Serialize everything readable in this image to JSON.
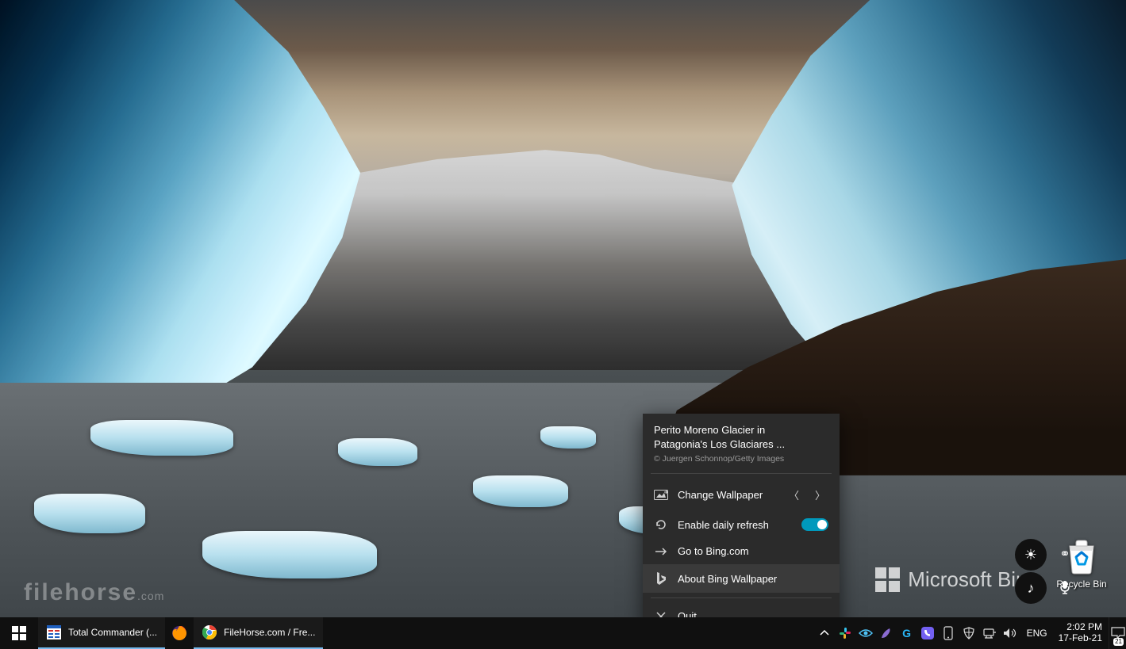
{
  "wallpaper_description": "Perito Moreno Glacier in Patagonia with snowy mountains and blue ice formations",
  "watermark": {
    "text": "filehorse",
    "suffix": ".com"
  },
  "desktop_icons": {
    "recycle_bin": "Recycle Bin"
  },
  "ms_bing_logo": "Microsoft Bing",
  "popup": {
    "title_line1": "Perito Moreno Glacier in",
    "title_line2": "Patagonia's Los Glaciares ...",
    "credit": "©  Juergen Schonnop/Getty Images",
    "items": {
      "change_wallpaper": "Change Wallpaper",
      "enable_daily_refresh": "Enable daily refresh",
      "go_to_bing": "Go to Bing.com",
      "about": "About Bing Wallpaper",
      "quit": "Quit"
    },
    "daily_refresh_enabled": true
  },
  "taskbar": {
    "apps": [
      {
        "id": "total-commander",
        "label": "Total Commander (..."
      },
      {
        "id": "firefox",
        "label": ""
      },
      {
        "id": "chrome",
        "label": "FileHorse.com / Fre..."
      }
    ],
    "tray_icons": [
      "chevron-up",
      "slack",
      "eye",
      "feather",
      "g-hub",
      "viber",
      "phone",
      "defender",
      "network",
      "volume"
    ],
    "language": "ENG",
    "time": "2:02 PM",
    "date": "17-Feb-21",
    "notification_count": "21"
  }
}
